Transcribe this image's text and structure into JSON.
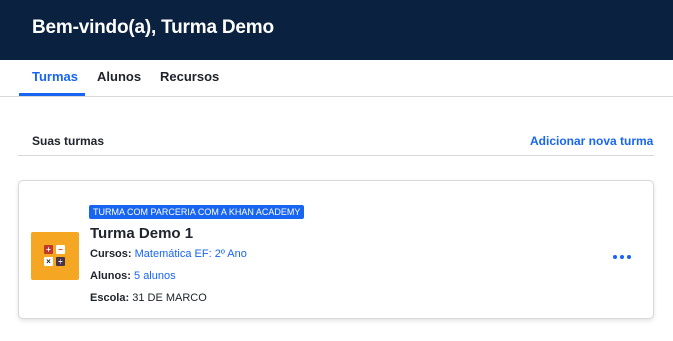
{
  "header": {
    "title": "Bem-vindo(a), Turma Demo"
  },
  "tabs": [
    {
      "label": "Turmas",
      "active": true
    },
    {
      "label": "Alunos",
      "active": false
    },
    {
      "label": "Recursos",
      "active": false
    }
  ],
  "section": {
    "label": "Suas turmas",
    "add_link": "Adicionar nova turma"
  },
  "class_card": {
    "badge": "TURMA COM PARCERIA COM A KHAN ACADEMY",
    "name": "Turma Demo 1",
    "courses_key": "Cursos:",
    "courses_value": "Matemática EF: 2º Ano",
    "students_key": "Alunos:",
    "students_value": "5 alunos",
    "school_key": "Escola:",
    "school_value": "31 DE MARCO",
    "icon": "math-operations-icon",
    "menu_icon": "more-options-icon"
  },
  "colors": {
    "header_bg": "#0a2240",
    "accent": "#1865f2",
    "icon_bg": "#f5a623"
  }
}
